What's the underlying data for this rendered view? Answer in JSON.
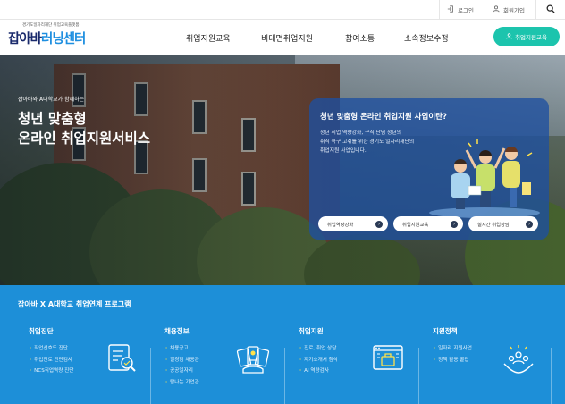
{
  "utility": {
    "login_label": "로그인",
    "join_label": "회원가입"
  },
  "logo": {
    "subtitle": "경기도일자리재단 취업교육플랫폼",
    "title_part1": "잡아바",
    "title_part2": "러닝센터"
  },
  "nav": {
    "items": [
      "취업지원교육",
      "비대면취업지원",
      "참여소통",
      "소속정보수정"
    ],
    "member_button": "취업지원교육"
  },
  "hero": {
    "subtitle": "잡아바와 A대학교가 함께하는",
    "title_line1": "청년 맞춤형",
    "title_line2": "온라인 취업지원서비스"
  },
  "info_card": {
    "title": "청년 맞춤형 온라인 취업지원 사업이란?",
    "desc_line1": "청년 취업 역량강화, 구직 단념 청년의",
    "desc_line2": "취직 욕구 고취를 위한 경기도 일자리재단의",
    "desc_line3": "취업지원 사업입니다.",
    "buttons": [
      "취업역량강화",
      "취업지원교육",
      "실시간 취업상담"
    ]
  },
  "program": {
    "title": "잡아바 X A대학교 취업연계 프로그램",
    "columns": [
      {
        "heading": "취업진단",
        "items": [
          "직업선호도 진단",
          "취업진로 진단검사",
          "NCS직업역량 진단"
        ],
        "icon": "diagnosis-icon"
      },
      {
        "heading": "채용정보",
        "items": [
          "채용공고",
          "일경험 채용관",
          "공공일자리",
          "탐나는 기업관"
        ],
        "icon": "job-info-icon"
      },
      {
        "heading": "취업지원",
        "items": [
          "진로, 취업 상담",
          "자기소개서 첨삭",
          "AI 역량검사"
        ],
        "icon": "employment-support-icon"
      },
      {
        "heading": "지원정책",
        "items": [
          "일자리 지원사업",
          "정책 활용 꿀팁"
        ],
        "icon": "policy-icon"
      }
    ]
  },
  "colors": {
    "accent": "#1cc4ad",
    "program_bg": "#1d8fd8",
    "card_bg": "#1e50a0",
    "logo_navy": "#1a2a6c",
    "logo_blue": "#1e8fe0"
  }
}
